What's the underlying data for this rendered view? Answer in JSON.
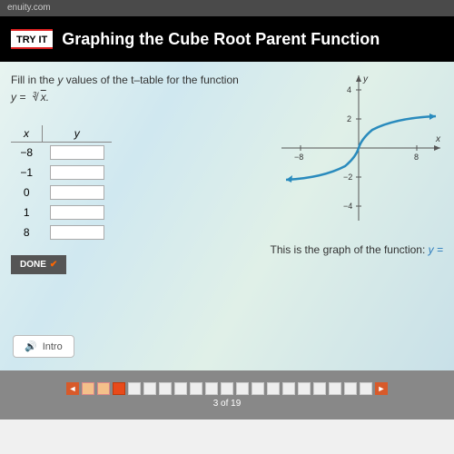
{
  "browser_url": "enuity.com",
  "header": {
    "badge": "TRY IT",
    "title": "Graphing the Cube Root Parent Function"
  },
  "instruction": {
    "line1_a": "Fill in the ",
    "line1_var": "y",
    "line1_b": " values of the t–table for the function",
    "formula_lhs": "y = ",
    "formula_index": "3",
    "formula_radicand": "x",
    "formula_end": "."
  },
  "table": {
    "col_x": "x",
    "col_y": "y",
    "rows": [
      {
        "x": "−8",
        "y": ""
      },
      {
        "x": "−1",
        "y": ""
      },
      {
        "x": "0",
        "y": ""
      },
      {
        "x": "1",
        "y": ""
      },
      {
        "x": "8",
        "y": ""
      }
    ]
  },
  "done_label": "DONE",
  "graph": {
    "y_label": "y",
    "x_label": "x",
    "ticks_x_neg": "−8",
    "ticks_x_pos": "8",
    "ticks_y_pos2": "2",
    "ticks_y_pos4": "4",
    "ticks_y_neg2": "−2",
    "ticks_y_neg4": "−4"
  },
  "graph_caption_a": "This is the graph of the function: ",
  "graph_caption_var": "y =",
  "intro_label": "Intro",
  "pager": {
    "total": 19,
    "current": 3,
    "done_upto": 2,
    "indicator": "3 of 19"
  },
  "chart_data": {
    "type": "line",
    "title": "",
    "xlabel": "x",
    "ylabel": "y",
    "xlim": [
      -10,
      10
    ],
    "ylim": [
      -5,
      5
    ],
    "series": [
      {
        "name": "y = cuberoot(x)",
        "x": [
          -8,
          -1,
          0,
          1,
          8
        ],
        "y": [
          -2,
          -1,
          0,
          1,
          2
        ]
      }
    ]
  }
}
